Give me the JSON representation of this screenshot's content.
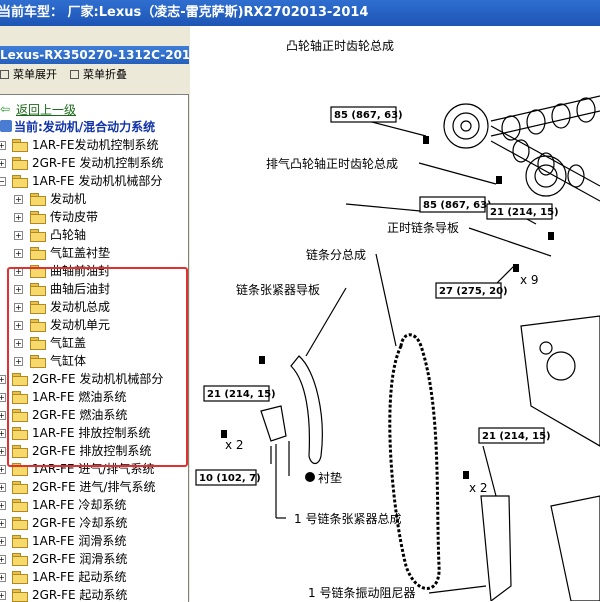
{
  "window": {
    "title": "当前车型： 厂家:Lexus（凌志-雷克萨斯)RX2702013-2014"
  },
  "panel": {
    "header": "Lexus-RX350270-1312C-2013-20",
    "menu": {
      "expand": "菜单展开",
      "collapse": "菜单折叠"
    }
  },
  "tree": {
    "back_link": "返回上一级",
    "current": "当前:发动机/混合动力系统",
    "items": [
      {
        "label": "1AR-FE发动机控制系统"
      },
      {
        "label": "2GR-FE 发动机控制系统"
      },
      {
        "label": "1AR-FE 发动机机械部分"
      },
      {
        "label": "发动机"
      },
      {
        "label": "传动皮带"
      },
      {
        "label": "凸轮轴"
      },
      {
        "label": "气缸盖衬垫"
      },
      {
        "label": "曲轴前油封"
      },
      {
        "label": "曲轴后油封"
      },
      {
        "label": "发动机总成"
      },
      {
        "label": "发动机单元"
      },
      {
        "label": "气缸盖"
      },
      {
        "label": "气缸体"
      },
      {
        "label": "2GR-FE 发动机机械部分"
      },
      {
        "label": "1AR-FE 燃油系统"
      },
      {
        "label": "2GR-FE 燃油系统"
      },
      {
        "label": "1AR-FE 排放控制系统"
      },
      {
        "label": "2GR-FE 排放控制系统"
      },
      {
        "label": "1AR-FE 进气/排气系统"
      },
      {
        "label": "2GR-FE 进气/排气系统"
      },
      {
        "label": "1AR-FE 冷却系统"
      },
      {
        "label": "2GR-FE 冷却系统"
      },
      {
        "label": "1AR-FE 润滑系统"
      },
      {
        "label": "2GR-FE 润滑系统"
      },
      {
        "label": "1AR-FE 起动系统"
      },
      {
        "label": "2GR-FE 起动系统"
      }
    ]
  },
  "diagram": {
    "labels": {
      "top_gear": "凸轮轴正时齿轮总成",
      "exhaust_gear": "排气凸轮轴正时齿轮总成",
      "timing_cover": "正时链条导板",
      "chain_sub": "链条分总成",
      "tensioner_guide": "链条张紧器导板",
      "gasket": "衬垫",
      "tensioner_assy": "1 号链条张紧器总成",
      "vibration_damper": "1 号链条振动阻尼器"
    },
    "torques": {
      "t1": "85 (867, 63)",
      "t2": "85 (867, 63)",
      "t3": "21 (214, 15)",
      "t4": "27 (275, 20)",
      "t5": "21 (214, 15)",
      "t6": "21 (214, 15)",
      "t7": "10 (102, 7)"
    },
    "qty": {
      "x9": "x 9",
      "x2a": "x 2",
      "x2b": "x 2"
    }
  }
}
